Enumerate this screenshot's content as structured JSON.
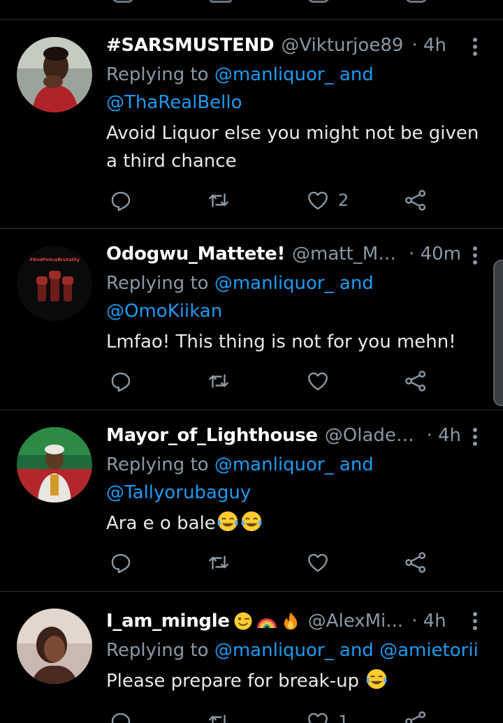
{
  "tweets": [
    {
      "display_name": "#SARSMUSTEND",
      "handle": "@Vikturjoe89",
      "time": "· 4h",
      "replying_prefix": "Replying to ",
      "reply_mention_1": "@manliquor_",
      "reply_and": " and",
      "reply_mention_2": "@ThaRealBello",
      "text": "Avoid Liquor else you might not be given a third chance",
      "like_count": "2"
    },
    {
      "display_name": "Odogwu_Mattete!",
      "handle": "@matt_Me...",
      "time": "· 40m",
      "replying_prefix": "Replying to ",
      "reply_mention_1": "@manliquor_",
      "reply_and": " and",
      "reply_mention_2": "@OmoKiikan",
      "text": "Lmfao! This thing is not for you mehn!",
      "avatar_text": "#EndPoliceBrutality",
      "like_count": ""
    },
    {
      "display_name": "Mayor_of_Lighthouse",
      "handle": "@Oladel...",
      "time": "· 4h",
      "replying_prefix": "Replying to ",
      "reply_mention_1": "@manliquor_",
      "reply_and": " and",
      "reply_mention_2": "@Tallyorubaguy",
      "text": "Ara e o bale",
      "like_count": ""
    },
    {
      "display_name": "I_am_mingle",
      "handle": "@AlexMi...",
      "time": "· 4h",
      "replying_prefix": "Replying to ",
      "reply_mention_1": "@manliquor_",
      "reply_and": " and ",
      "reply_mention_2": "@amietorii",
      "text": "Please prepare for break-up ",
      "like_count": "1"
    }
  ],
  "icons": {
    "reply": "reply-icon",
    "retweet": "retweet-icon",
    "like": "heart-icon",
    "share": "share-icon",
    "more": "more-vertical-icon"
  },
  "colors": {
    "background": "#000000",
    "text": "#e7e9ea",
    "muted": "#8b98a5",
    "link": "#1d9bf0",
    "divider": "#2f3336"
  }
}
